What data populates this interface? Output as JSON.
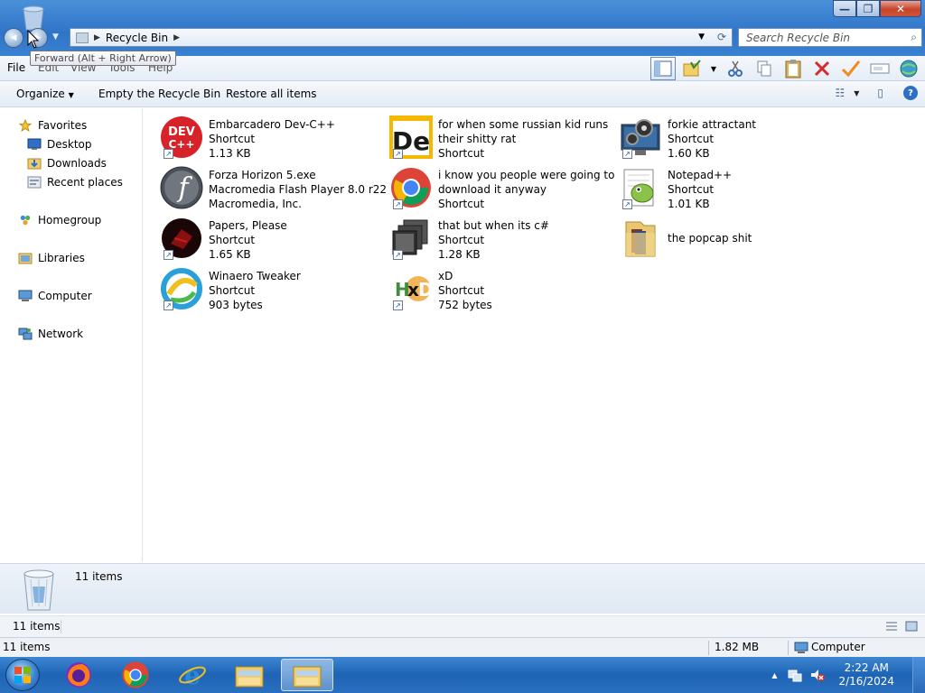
{
  "window": {
    "min_glyph": "—",
    "max_glyph": "❐",
    "close_glyph": "✕"
  },
  "nav": {
    "back_glyph": "◀",
    "forward_glyph": "▶",
    "tooltip": "Forward (Alt + Right Arrow)"
  },
  "address": {
    "crumb": "Recycle Bin",
    "sep_glyph": "▶",
    "dropdown_glyph": "▼",
    "refresh_glyph": "⟳"
  },
  "search": {
    "placeholder": "Search Recycle Bin",
    "icon_glyph": "⌕"
  },
  "menu": {
    "items": [
      "File",
      "Edit",
      "View",
      "Tools",
      "Help"
    ]
  },
  "commands": {
    "organize": "Organize",
    "organize_arrow": "▼",
    "empty": "Empty the Recycle Bin",
    "restore": "Restore all items",
    "views_glyph": "☷",
    "views_arrow": "▼",
    "preview_glyph": "▯",
    "help_glyph": "?"
  },
  "navpane": {
    "favorites": "Favorites",
    "desktop": "Desktop",
    "downloads": "Downloads",
    "recent": "Recent places",
    "homegroup": "Homegroup",
    "libraries": "Libraries",
    "computer": "Computer",
    "network": "Network"
  },
  "items": [
    {
      "name": "Embarcadero Dev-C++",
      "line2": "Shortcut",
      "line3": "1.13 KB",
      "icon_text": "DEV C++",
      "color": "#d8222a"
    },
    {
      "name": "for when some russian kid runs",
      "line2": "their shitty rat",
      "line3": "Shortcut",
      "icon_text": "De",
      "color": "#f5b800"
    },
    {
      "name": "forkie attractant",
      "line2": "Shortcut",
      "line3": "1.60 KB",
      "icon_text": "",
      "color": "#2b4d75"
    },
    {
      "name": "Forza Horizon 5.exe",
      "line2": "Macromedia Flash Player 8.0  r22",
      "line3": "Macromedia, Inc.",
      "icon_text": "f",
      "color": "#4a5058"
    },
    {
      "name": "i know you people were going to",
      "line2": "download it anyway",
      "line3": "Shortcut",
      "icon_text": "",
      "color": "#4285f4"
    },
    {
      "name": "Notepad++",
      "line2": "Shortcut",
      "line3": "1.01 KB",
      "icon_text": "",
      "color": "#8bc34a"
    },
    {
      "name": "Papers, Please",
      "line2": "Shortcut",
      "line3": "1.65 KB",
      "icon_text": "",
      "color": "#2a0a0a"
    },
    {
      "name": "that but when its c#",
      "line2": "Shortcut",
      "line3": "1.28 KB",
      "icon_text": "",
      "color": "#333333"
    },
    {
      "name": "the popcap shit",
      "line2": "",
      "line3": "",
      "icon_text": "",
      "color": "#e8c873"
    },
    {
      "name": "Winaero Tweaker",
      "line2": "Shortcut",
      "line3": "903 bytes",
      "icon_text": "",
      "color": "#2aa0d8"
    },
    {
      "name": "xD",
      "line2": "Shortcut",
      "line3": "752 bytes",
      "icon_text": "HxD",
      "color": "#3e8e3e"
    }
  ],
  "details": {
    "count": "11 items"
  },
  "status": {
    "items_top": "11 items",
    "items_bottom": "11 items",
    "size": "1.82 MB",
    "location": "Computer"
  },
  "taskbar": {
    "time": "2:22 AM",
    "date": "2/16/2024",
    "tray_up_glyph": "▲"
  }
}
